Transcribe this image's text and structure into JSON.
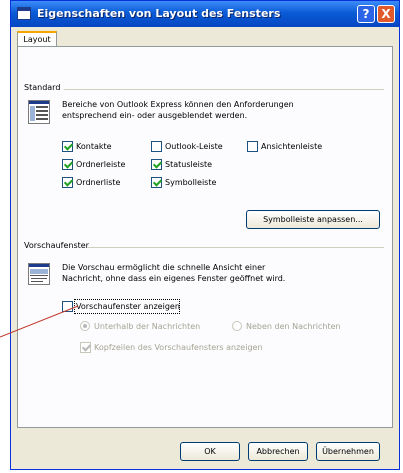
{
  "window": {
    "title": "Eigenschaften von Layout des Fensters"
  },
  "title_buttons": {
    "help": "?",
    "close": "X"
  },
  "tab": {
    "label": "Layout"
  },
  "standard": {
    "group_label": "Standard",
    "description_line1": "Bereiche von Outlook Express können den Anforderungen",
    "description_line2": "entsprechend ein- oder ausgeblendet werden.",
    "checkboxes": [
      {
        "label": "Kontakte",
        "checked": true
      },
      {
        "label": "Outlook-Leiste",
        "checked": false
      },
      {
        "label": "Ansichtenleiste",
        "checked": false
      },
      {
        "label": "Ordnerleiste",
        "checked": true
      },
      {
        "label": "Statusleiste",
        "checked": true
      },
      {
        "label": "Ordnerliste",
        "checked": true
      },
      {
        "label": "Symbolleiste",
        "checked": true
      }
    ],
    "customize_button": "Symbolleiste anpassen..."
  },
  "preview": {
    "group_label": "Vorschaufenster",
    "description_line1": "Die Vorschau ermöglicht die schnelle Ansicht einer",
    "description_line2": "Nachricht, ohne dass ein eigenes Fenster geöffnet wird.",
    "show_checkbox": {
      "label": "Vorschaufenster anzeigen",
      "checked": false
    },
    "radios": [
      {
        "label": "Unterhalb der Nachrichten",
        "selected": true
      },
      {
        "label": "Neben den Nachrichten",
        "selected": false
      }
    ],
    "header_checkbox": {
      "label": "Kopfzeilen des Vorschaufensters anzeigen",
      "checked": true
    }
  },
  "buttons": {
    "ok": "OK",
    "cancel": "Abbrechen",
    "apply": "Übernehmen"
  },
  "colors": {
    "titlebar": "#0a5bd6",
    "check": "#21a121",
    "tab_highlight": "#f7a600",
    "pointer": "#c0392b"
  }
}
